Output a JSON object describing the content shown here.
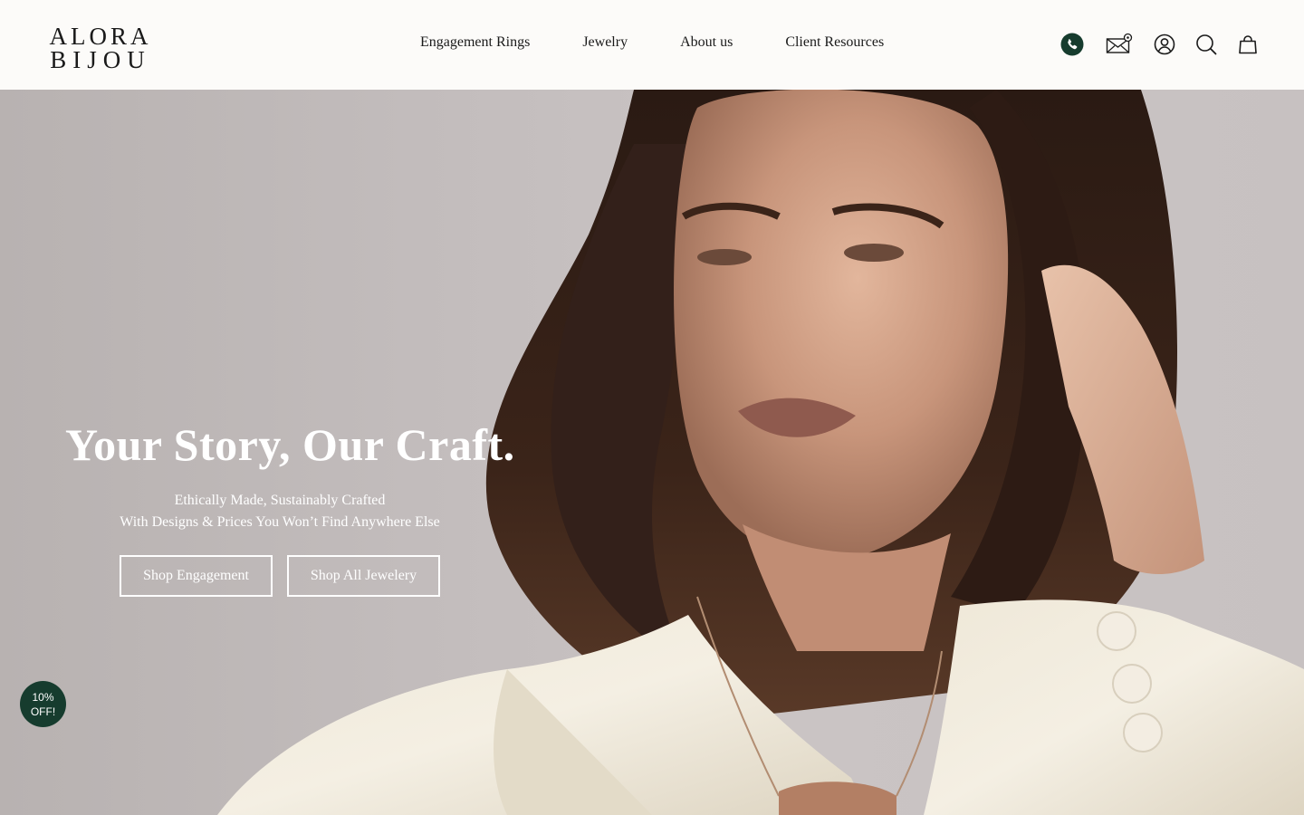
{
  "brand": {
    "line1": "ALORA",
    "line2": "BIJOU"
  },
  "nav": {
    "items": [
      {
        "label": "Engagement Rings"
      },
      {
        "label": "Jewelry"
      },
      {
        "label": "About us"
      },
      {
        "label": "Client Resources"
      }
    ]
  },
  "header_icons": [
    "phone-icon",
    "mail-icon",
    "account-icon",
    "search-icon",
    "cart-icon"
  ],
  "colors": {
    "accent": "#163c2e",
    "background": "#fcfbf9",
    "text": "#1a1a1a"
  },
  "hero": {
    "title": "Your Story, Our Craft.",
    "subtitle_line1": "Ethically Made, Sustainably Crafted",
    "subtitle_line2": "With Designs & Prices You Won’t Find Anywhere Else",
    "button_engagement": "Shop Engagement",
    "button_all": "Shop All Jewelery"
  },
  "discount_badge": {
    "line1": "10%",
    "line2": "OFF!"
  }
}
